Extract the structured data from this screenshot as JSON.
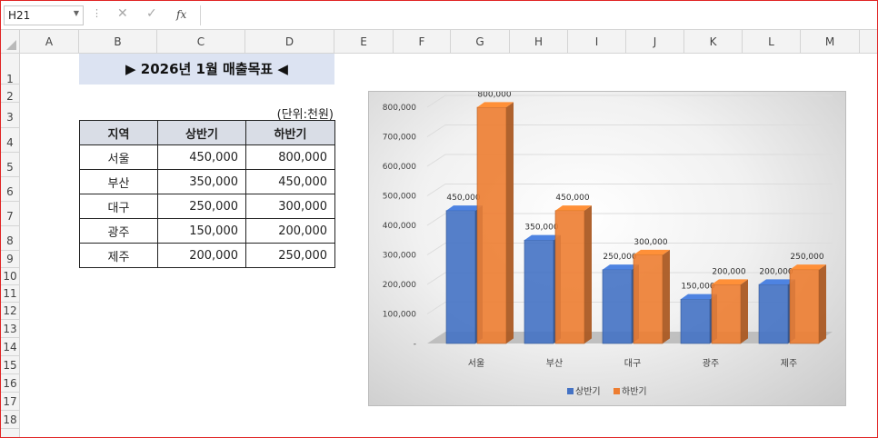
{
  "formula_bar": {
    "name_box": "H21",
    "cancel_icon": "✕",
    "enter_icon": "✓",
    "fx_label": "fx",
    "formula": ""
  },
  "columns": [
    "A",
    "B",
    "C",
    "D",
    "E",
    "F",
    "G",
    "H",
    "I",
    "J",
    "K",
    "L",
    "M"
  ],
  "rows": [
    "1",
    "2",
    "3",
    "4",
    "5",
    "6",
    "7",
    "8",
    "9",
    "10",
    "11",
    "12",
    "13",
    "14",
    "15",
    "16",
    "17",
    "18"
  ],
  "sheet": {
    "title": "▶ 2026년 1월 매출목표 ◀",
    "unit": "(단위:천원)",
    "headers": [
      "지역",
      "상반기",
      "하반기"
    ],
    "rows": [
      {
        "region": "서울",
        "h1": "450,000",
        "h2": "800,000"
      },
      {
        "region": "부산",
        "h1": "350,000",
        "h2": "450,000"
      },
      {
        "region": "대구",
        "h1": "250,000",
        "h2": "300,000"
      },
      {
        "region": "광주",
        "h1": "150,000",
        "h2": "200,000"
      },
      {
        "region": "제주",
        "h1": "200,000",
        "h2": "250,000"
      }
    ]
  },
  "chart_data": {
    "type": "bar",
    "categories": [
      "서울",
      "부산",
      "대구",
      "광주",
      "제주"
    ],
    "series": [
      {
        "name": "상반기",
        "values": [
          450000,
          350000,
          250000,
          150000,
          200000
        ],
        "color": "#4472c4"
      },
      {
        "name": "하반기",
        "values": [
          800000,
          450000,
          300000,
          200000,
          250000
        ],
        "color": "#ed7d31"
      }
    ],
    "ylim": [
      0,
      800000
    ],
    "yticks": [
      "-",
      "100,000",
      "200,000",
      "300,000",
      "400,000",
      "500,000",
      "600,000",
      "700,000",
      "800,000"
    ],
    "data_labels": [
      [
        "450,000",
        "350,000",
        "250,000",
        "150,000",
        "200,000"
      ],
      [
        "800,000",
        "450,000",
        "300,000",
        "200,000",
        "250,000"
      ]
    ],
    "grid": true,
    "legend": "bottom",
    "title": "",
    "xlabel": "",
    "ylabel": ""
  }
}
